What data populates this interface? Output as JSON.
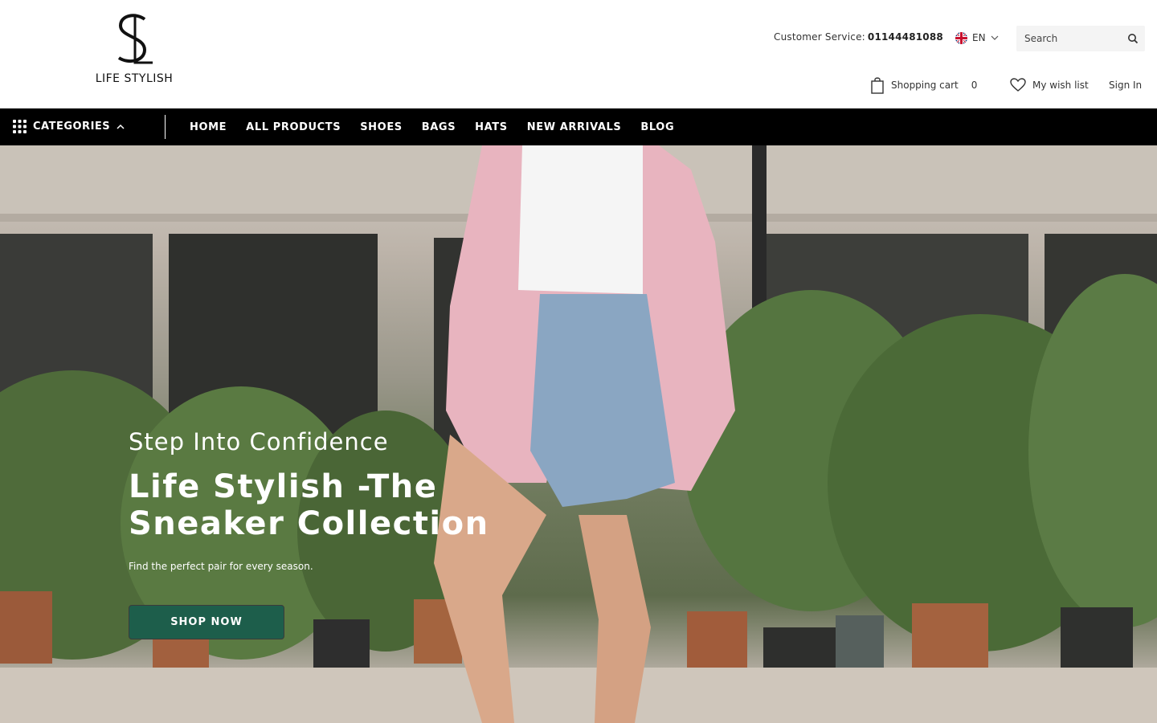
{
  "brand": {
    "logo_text": "LIFE STYLISH",
    "logo_mark": "SL-monogram"
  },
  "header": {
    "customer_service_label": "Customer Service:",
    "customer_service_phone": "01144481088",
    "language": "EN",
    "search": {
      "placeholder": "Search"
    },
    "cart": {
      "label": "Shopping cart",
      "count": "0"
    },
    "wishlist_label": "My wish list",
    "signin_label": "Sign In"
  },
  "nav": {
    "categories_label": "CATEGORIES",
    "items": [
      {
        "label": "HOME"
      },
      {
        "label": "ALL PRODUCTS"
      },
      {
        "label": "SHOES"
      },
      {
        "label": "BAGS"
      },
      {
        "label": "HATS"
      },
      {
        "label": "NEW ARRIVALS"
      },
      {
        "label": "BLOG"
      }
    ]
  },
  "hero": {
    "subtitle": "Step Into Confidence",
    "title": "Life Stylish -The Sneaker Collection",
    "description": "Find the perfect pair for every season.",
    "cta_label": "SHOP NOW"
  },
  "colors": {
    "nav_bg": "#000000",
    "cta_bg": "#1d5e4b",
    "header_bg": "#ffffff"
  },
  "icons": [
    "grid-icon",
    "chevron-up-icon",
    "uk-flag-icon",
    "chevron-down-icon",
    "search-icon",
    "shopping-bag-icon",
    "heart-icon"
  ]
}
